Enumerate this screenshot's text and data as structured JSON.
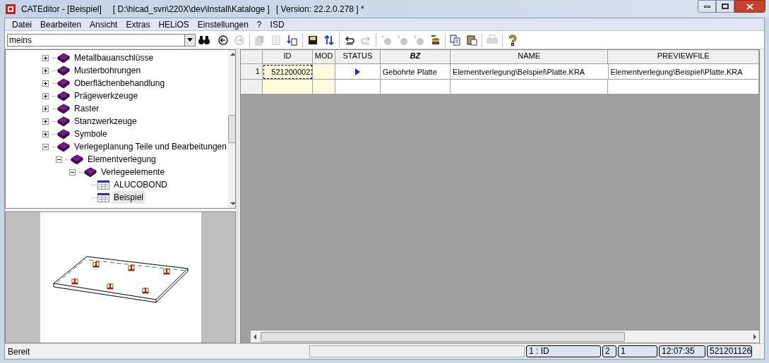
{
  "window": {
    "app": "CATEditor - [Beispiel]",
    "path": "[ D:\\hicad_svn\\220X\\dev\\Install\\Kataloge ]",
    "version": "[ Version: 22.2.0.278 ] *"
  },
  "menu": [
    "Datei",
    "Bearbeiten",
    "Ansicht",
    "Extras",
    "HELiOS",
    "Einstellungen",
    "?",
    "ISD"
  ],
  "toolbar": {
    "search": {
      "value": "meins"
    },
    "buttons": [
      {
        "kind": "back",
        "disabled": false
      },
      {
        "kind": "forward",
        "disabled": true
      },
      {
        "kind": "copy-record",
        "disabled": true
      },
      {
        "kind": "document",
        "disabled": true
      },
      {
        "kind": "insert",
        "disabled": false
      },
      {
        "kind": "save",
        "disabled": false
      },
      {
        "kind": "sort",
        "disabled": false
      },
      {
        "kind": "undo",
        "disabled": false
      },
      {
        "kind": "redo",
        "disabled": true
      },
      {
        "kind": "add-db",
        "disabled": true
      },
      {
        "kind": "add-db",
        "disabled": true
      },
      {
        "kind": "add-db",
        "disabled": true
      },
      {
        "kind": "db-stack",
        "disabled": false
      },
      {
        "kind": "copy",
        "disabled": false
      },
      {
        "kind": "paste",
        "disabled": false
      },
      {
        "kind": "print",
        "disabled": true
      },
      {
        "kind": "help",
        "disabled": false
      }
    ]
  },
  "tree": [
    {
      "label": "Metallbauanschlüsse",
      "kind": "folder",
      "expanded": false,
      "selected": false
    },
    {
      "label": "Musterbohrungen",
      "kind": "folder",
      "expanded": false,
      "selected": false
    },
    {
      "label": "Oberflächenbehandlung",
      "kind": "folder",
      "expanded": false,
      "selected": false
    },
    {
      "label": "Prägewerkzeuge",
      "kind": "folder",
      "expanded": false,
      "selected": false
    },
    {
      "label": "Raster",
      "kind": "folder",
      "expanded": false,
      "selected": false
    },
    {
      "label": "Stanzwerkzeuge",
      "kind": "folder",
      "expanded": false,
      "selected": false
    },
    {
      "label": "Symbole",
      "kind": "folder",
      "expanded": false,
      "selected": false
    },
    {
      "label": "Verlegeplanung Teile und Bearbeitungen",
      "kind": "folder",
      "expanded": true,
      "selected": false,
      "children": [
        {
          "label": "Elementverlegung",
          "kind": "folder",
          "expanded": true,
          "selected": false,
          "children": [
            {
              "label": "Verlegeelemente",
              "kind": "folder",
              "expanded": true,
              "selected": false,
              "children": [
                {
                  "label": "ALUCOBOND",
                  "kind": "table",
                  "selected": false
                },
                {
                  "label": "Beispiel",
                  "kind": "table",
                  "selected": true
                }
              ]
            }
          ]
        }
      ]
    }
  ],
  "grid": {
    "columns": [
      {
        "label": "ID",
        "readonly": true,
        "emphasized": false
      },
      {
        "label": "MOD",
        "readonly": true,
        "emphasized": false
      },
      {
        "label": "STATUS",
        "readonly": false,
        "emphasized": false
      },
      {
        "label": "BZ",
        "readonly": false,
        "emphasized": true
      },
      {
        "label": "NAME",
        "readonly": false,
        "emphasized": false
      },
      {
        "label": "PREVIEWFILE",
        "readonly": false,
        "emphasized": false
      }
    ],
    "rows": [
      {
        "number": "1",
        "current": true,
        "cells": [
          {
            "text": "521200002",
            "focused": true
          },
          {
            "text": "",
            "focused": false
          },
          {
            "text": "",
            "focused": false
          },
          {
            "text": "Gebohrte Platte",
            "focused": false
          },
          {
            "text": "Elementverlegung\\Beispiel\\Platte.KRA",
            "focused": false
          },
          {
            "text": "Elementverlegung\\Beispiel\\Platte.KRA",
            "focused": false
          }
        ]
      }
    ]
  },
  "status_bar": {
    "message": "Bereit",
    "panes": [
      "1 : ID",
      "2",
      "1",
      "12:07:35",
      "521201126"
    ]
  }
}
